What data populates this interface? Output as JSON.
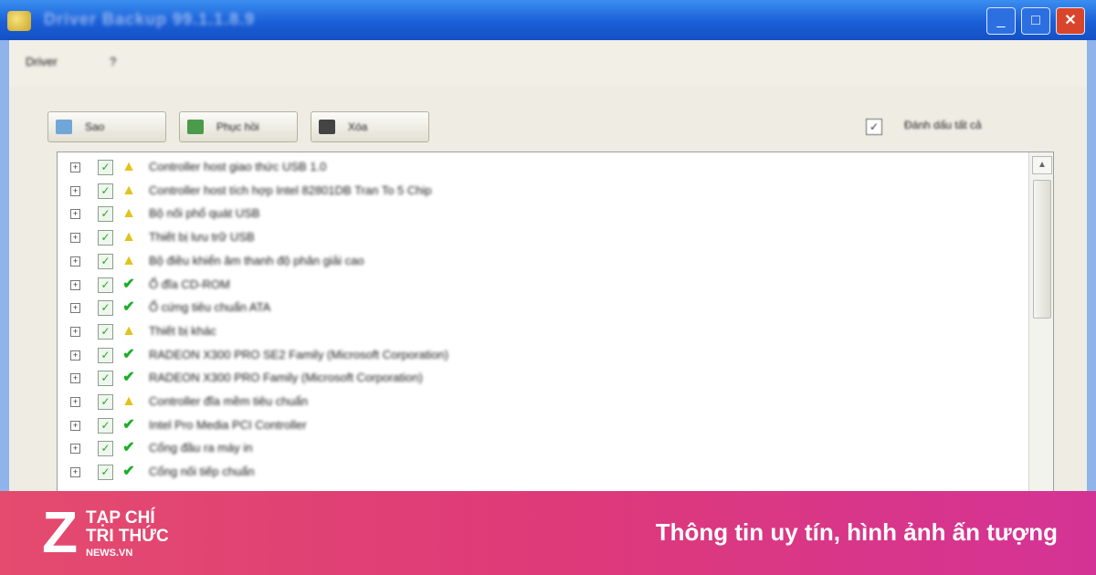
{
  "window": {
    "title": "Driver Backup 99.1.1.8.9",
    "min_glyph": "_",
    "max_glyph": "□",
    "close_glyph": "✕"
  },
  "menu": {
    "items": [
      "Driver",
      "?"
    ]
  },
  "toolbar": {
    "buttons": [
      {
        "label": "Sao",
        "icon": "save-icon",
        "color": "#6fa7d8"
      },
      {
        "label": "Phục hồi",
        "icon": "restore-icon",
        "color": "#4c9a4c"
      },
      {
        "label": "Xóa",
        "icon": "delete-icon",
        "color": "#444444"
      }
    ],
    "select_all_label": "Đánh dấu tất cả",
    "select_all_glyph": "✓"
  },
  "list": {
    "rows": [
      {
        "label": "Controller host giao thức USB 1.0",
        "status": "warn"
      },
      {
        "label": "Controller host tích hợp Intel 82801DB Tran To 5 Chip",
        "status": "warn"
      },
      {
        "label": "Bộ nối phổ quát USB",
        "status": "warn"
      },
      {
        "label": "Thiết bị lưu trữ USB",
        "status": "warn"
      },
      {
        "label": "Bộ điều khiển âm thanh độ phân giải cao",
        "status": "warn"
      },
      {
        "label": "Ổ đĩa CD-ROM",
        "status": "ok"
      },
      {
        "label": "Ổ cứng tiêu chuẩn ATA",
        "status": "ok"
      },
      {
        "label": "Thiết bị khác",
        "status": "warn"
      },
      {
        "label": "RADEON X300 PRO SE2 Family (Microsoft Corporation)",
        "status": "ok"
      },
      {
        "label": "RADEON X300 PRO Family (Microsoft Corporation)",
        "status": "ok"
      },
      {
        "label": "Controller đĩa mềm tiêu chuẩn",
        "status": "warn"
      },
      {
        "label": "Intel Pro Media PCI Controller",
        "status": "ok"
      },
      {
        "label": "Cổng đầu ra máy in",
        "status": "ok"
      },
      {
        "label": "Cổng nối tiếp chuẩn",
        "status": "ok"
      }
    ],
    "expander_glyph": "+",
    "check_glyph": "✓",
    "warn_glyph": "▲",
    "ok_glyph": "✔",
    "scroll_up_glyph": "▲"
  },
  "banner": {
    "logo_letter": "Z",
    "logo_line1": "TẠP CHÍ",
    "logo_line2": "TRI THỨC",
    "logo_line3": "NEWS.VN",
    "slogan": "Thông tin uy tín, hình ảnh ấn tượng"
  },
  "colors": {
    "banner_left": "#e44b6e",
    "banner_right": "#d43395",
    "titlebar": "#1a5fd8",
    "warn": "#e2c21e",
    "ok": "#1eae2a"
  }
}
